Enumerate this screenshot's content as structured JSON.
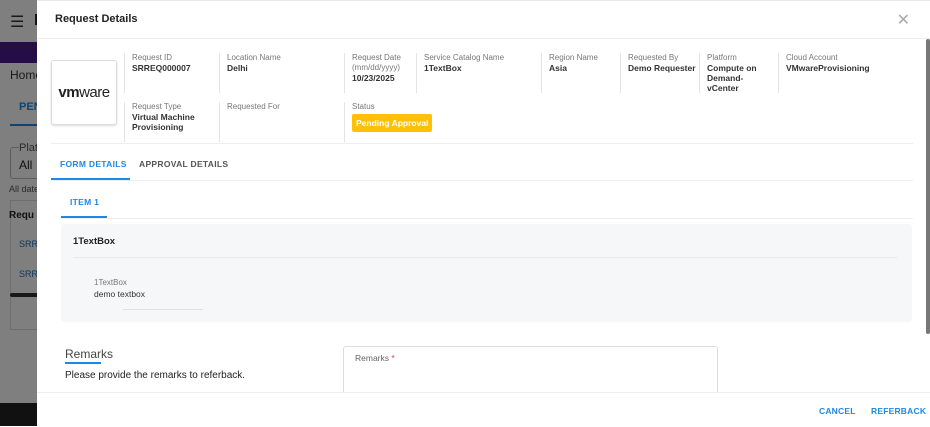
{
  "background": {
    "menu_icon": "hamburger-icon",
    "brand": "I",
    "home": "Home",
    "tab": "PENI",
    "select_label": "Plat",
    "select_value": "All",
    "dates_text": "All date",
    "table_header": "Requ",
    "rows": [
      "SRRE",
      "SRRE"
    ]
  },
  "modal": {
    "title": "Request Details",
    "close_icon": "close-icon",
    "logo_text": {
      "bold": "vm",
      "rest": "ware"
    },
    "fields": [
      {
        "label": "Request ID",
        "value": "SRREQ000007"
      },
      {
        "label": "Location Name",
        "value": "Delhi"
      },
      {
        "label": "Request Date (mm/dd/yyyy)",
        "value": "10/23/2025"
      },
      {
        "label": "Service Catalog Name",
        "value": "1TextBox"
      },
      {
        "label": "Region Name",
        "value": "Asia"
      },
      {
        "label": "Requested By",
        "value": "Demo Requester"
      },
      {
        "label": "Platform",
        "value": "Compute on Demand-vCenter"
      },
      {
        "label": "Cloud Account",
        "value": "VMwareProvisioning"
      },
      {
        "label": "Request Type",
        "value": "Virtual Machine Provisioning"
      },
      {
        "label": "Requested For",
        "value": ""
      },
      {
        "label": "Status",
        "value": "Pending Approval"
      }
    ],
    "status_color": "#ffc107",
    "tabs": [
      "FORM DETAILS",
      "APPROVAL DETAILS"
    ],
    "item_tabs": [
      "ITEM 1"
    ],
    "panel": {
      "title": "1TextBox",
      "field_label": "1TextBox",
      "field_value": "demo textbox"
    },
    "remarks": {
      "heading": "Remarks",
      "instruction": "Please provide the remarks to referback.",
      "input_label": "Remarks",
      "required_mark": "*"
    },
    "buttons": {
      "cancel": "CANCEL",
      "referback": "REFERBACK"
    },
    "accent": "#1e88e5"
  }
}
